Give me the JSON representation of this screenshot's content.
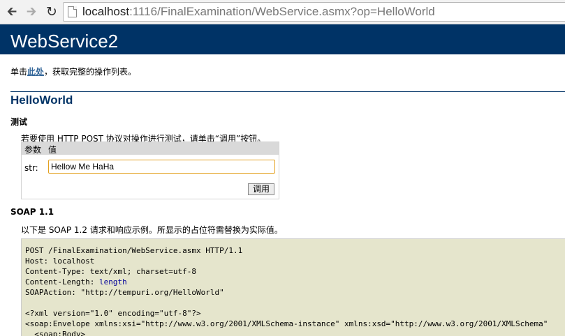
{
  "browser": {
    "url_host": "localhost",
    "url_rest": ":1116/FinalExamination/WebService.asmx?op=HelloWorld"
  },
  "header": {
    "title": "WebService2"
  },
  "intro": {
    "prefix": "单击",
    "link": "此处",
    "suffix": "，获取完整的操作列表。"
  },
  "operation": {
    "name": "HelloWorld",
    "test_heading": "测试",
    "test_desc": "若要使用 HTTP POST 协议对操作进行测试，请单击“调用”按钮。",
    "table_header_param": "参数",
    "table_header_value": "值",
    "param_label": "str:",
    "param_value": "Hellow Me HaHa",
    "invoke_label": "调用"
  },
  "soap": {
    "heading": "SOAP 1.1",
    "desc": "以下是 SOAP 1.2 请求和响应示例。所显示的占位符需替换为实际值。",
    "line1": "POST /FinalExamination/WebService.asmx HTTP/1.1",
    "line2": "Host: localhost",
    "line3": "Content-Type: text/xml; charset=utf-8",
    "line4_prefix": "Content-Length: ",
    "line4_placeholder": "length",
    "line5": "SOAPAction: \"http://tempuri.org/HelloWorld\"",
    "line7": "<?xml version=\"1.0\" encoding=\"utf-8\"?>",
    "line8": "<soap:Envelope xmlns:xsi=\"http://www.w3.org/2001/XMLSchema-instance\" xmlns:xsd=\"http://www.w3.org/2001/XMLSchema\"",
    "line9": "  <soap:Body>"
  }
}
